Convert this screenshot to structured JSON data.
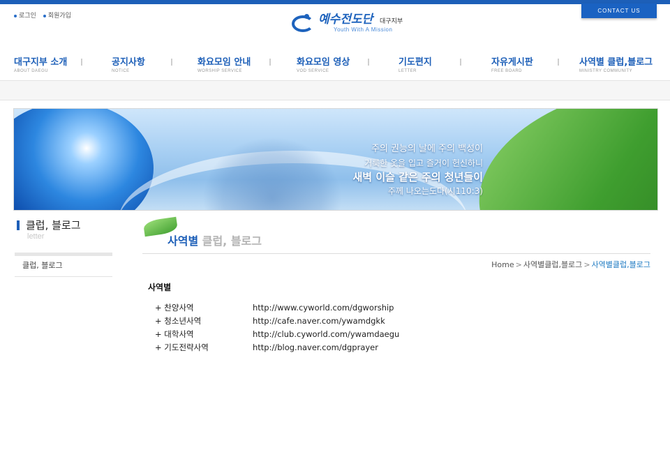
{
  "header": {
    "util_links": [
      "로그인",
      "회원가입"
    ],
    "contact_label": "CONTACT US",
    "logo": {
      "main": "예수전도단",
      "branch": "대구지부",
      "sub": "Youth With A Mission"
    }
  },
  "nav": [
    {
      "ko": "대구지부 소개",
      "en": "ABOUT DAEGU"
    },
    {
      "ko": "공지사항",
      "en": "NOTICE"
    },
    {
      "ko": "화요모임 안내",
      "en": "WORSHIP SERVICE"
    },
    {
      "ko": "화요모임 영상",
      "en": "VOD SERVICE"
    },
    {
      "ko": "기도편지",
      "en": "LETTER"
    },
    {
      "ko": "자유게시판",
      "en": "FREE BOARD"
    },
    {
      "ko": "사역별 클럽,블로그",
      "en": "MINISTRY COMMUNITY"
    }
  ],
  "banner": {
    "line1": "주의 권능의 날에 주의 백성이",
    "line2": "거룩한 옷을 입고 즐거이 헌신하니",
    "line3": "새벽 이슬 같은 주의 청년들이",
    "line4": "주께 나오는도다(시110:3)"
  },
  "sidebar": {
    "title": "클럽, 블로그",
    "title_en": "letter",
    "items": [
      "클럽, 블로그"
    ]
  },
  "page": {
    "title_strong": "사역별",
    "title_light": " 클럽, 블로그",
    "breadcrumb": [
      "Home",
      "사역별클럽,블로그",
      "사역별클럽,블로그"
    ],
    "section_title": "사역별",
    "links": [
      {
        "name": "+ 찬양사역",
        "url": "http://www.cyworld.com/dgworship"
      },
      {
        "name": "+ 청소년사역",
        "url": "http://cafe.naver.com/ywamdgkk"
      },
      {
        "name": "+ 대학사역",
        "url": "http://club.cyworld.com/ywamdaegu"
      },
      {
        "name": "+ 기도전략사역",
        "url": "http://blog.naver.com/dgprayer"
      }
    ]
  },
  "colors": {
    "accent": "#1d5fb8",
    "breadcrumb_current": "#1d7ac2"
  }
}
